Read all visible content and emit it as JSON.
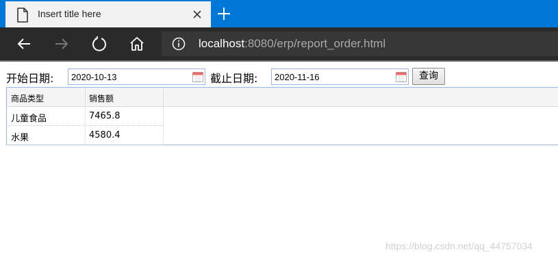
{
  "browser": {
    "tab_title": "Insert title here",
    "address": {
      "host": "localhost",
      "rest": ":8080/erp/report_order.html"
    }
  },
  "filters": {
    "start_label": "开始日期:",
    "start_value": "2020-10-13",
    "end_label": "截止日期:",
    "end_value": "2020-11-16",
    "query_label": "查询"
  },
  "grid": {
    "columns": [
      "商品类型",
      "销售额"
    ],
    "rows": [
      [
        "儿童食品",
        "7465.8"
      ],
      [
        "水果",
        "4580.4"
      ]
    ]
  },
  "watermark": "https://blog.csdn.net/qq_44757034",
  "colors": {
    "tabbar": "#0078d7",
    "toolbar": "#2b2b2b",
    "border": "#95b8e7"
  },
  "icons": [
    "page-icon",
    "close-icon",
    "plus-icon",
    "back-arrow-icon",
    "forward-arrow-icon",
    "refresh-icon",
    "home-icon",
    "info-icon",
    "calendar-icon"
  ]
}
